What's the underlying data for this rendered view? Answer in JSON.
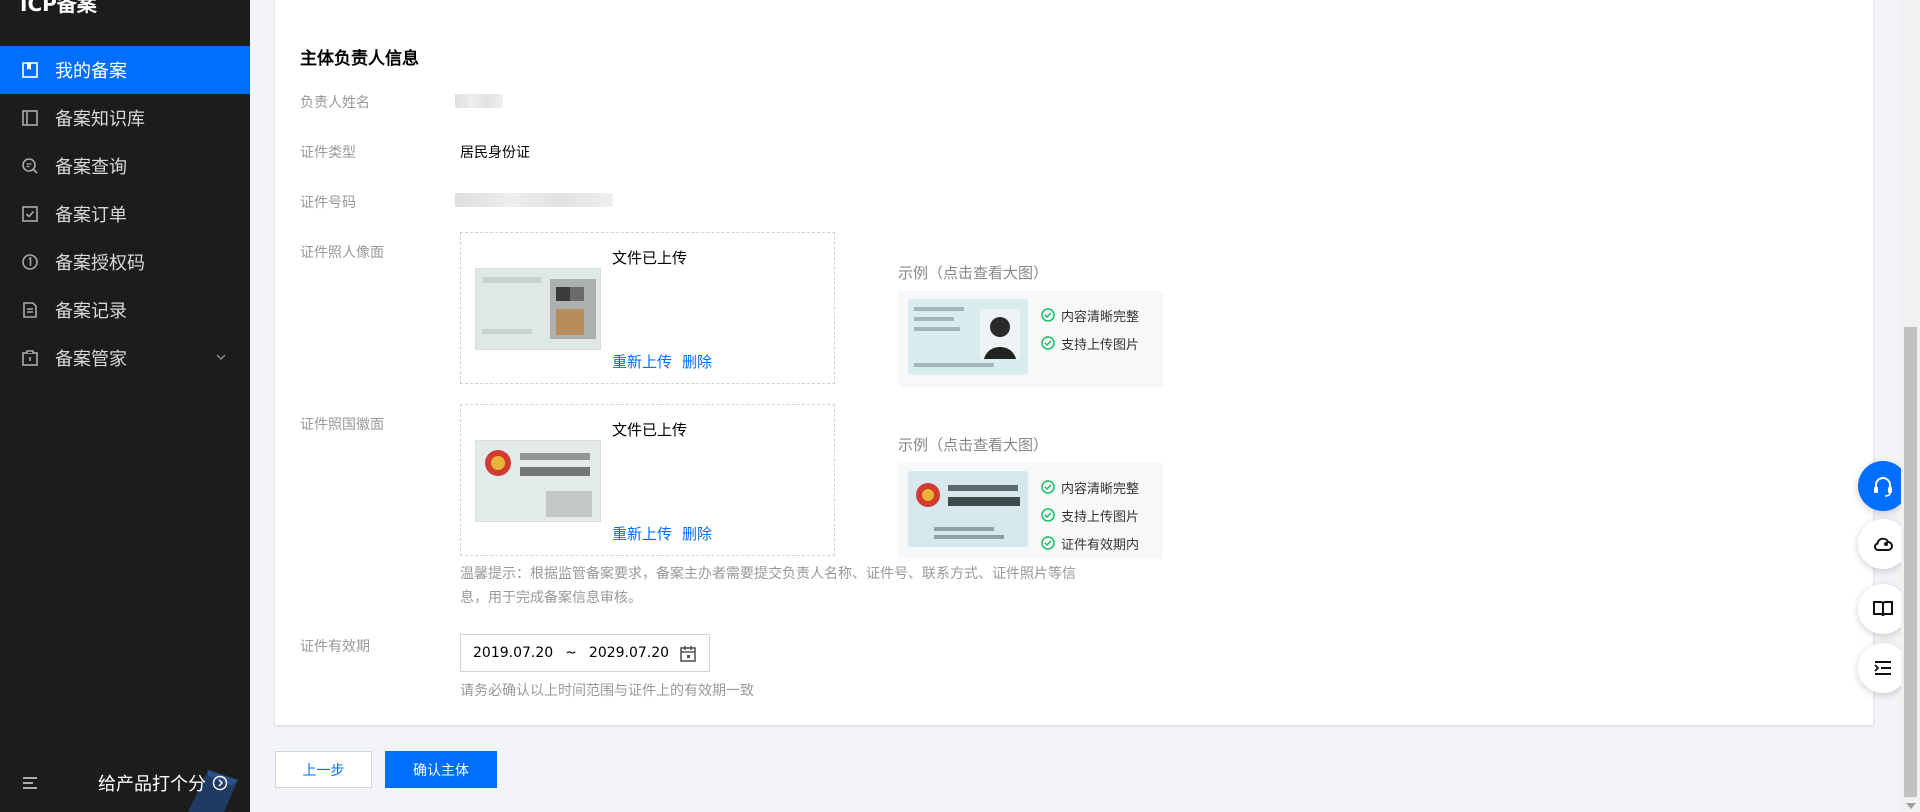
{
  "sidebar": {
    "title": "ICP备案",
    "items": [
      {
        "label": "我的备案",
        "active": true
      },
      {
        "label": "备案知识库"
      },
      {
        "label": "备案查询"
      },
      {
        "label": "备案订单"
      },
      {
        "label": "备案授权码"
      },
      {
        "label": "备案记录"
      },
      {
        "label": "备案管家",
        "expandable": true
      }
    ],
    "footer": {
      "rate_label": "给产品打个分"
    }
  },
  "form": {
    "section_title": "主体负责人信息",
    "fields": {
      "name_label": "负责人姓名",
      "id_type_label": "证件类型",
      "id_type_value": "居民身份证",
      "id_number_label": "证件号码",
      "front_label": "证件照人像面",
      "back_label": "证件照国徽面",
      "validity_label": "证件有效期"
    },
    "front_upload": {
      "status": "文件已上传",
      "reupload": "重新上传",
      "delete": "删除"
    },
    "back_upload": {
      "status": "文件已上传",
      "reupload": "重新上传",
      "delete": "删除"
    },
    "front_example": {
      "title": "示例（点击查看大图）",
      "checks": [
        "内容清晰完整",
        "支持上传图片"
      ]
    },
    "back_example": {
      "title": "示例（点击查看大图）",
      "checks": [
        "内容清晰完整",
        "支持上传图片",
        "证件有效期内"
      ]
    },
    "tip": "温馨提示：根据监管备案要求，备案主办者需要提交负责人名称、证件号、联系方式、证件照片等信息，用于完成备案信息审核。",
    "validity": {
      "start": "2019.07.20",
      "separator": "~",
      "end": "2029.07.20",
      "hint": "请务必确认以上时间范围与证件上的有效期一致"
    }
  },
  "actions": {
    "prev": "上一步",
    "confirm": "确认主体"
  },
  "colors": {
    "accent": "#006eff",
    "sidebar_bg": "#1c1c1c",
    "check_green": "#0abf5b"
  }
}
